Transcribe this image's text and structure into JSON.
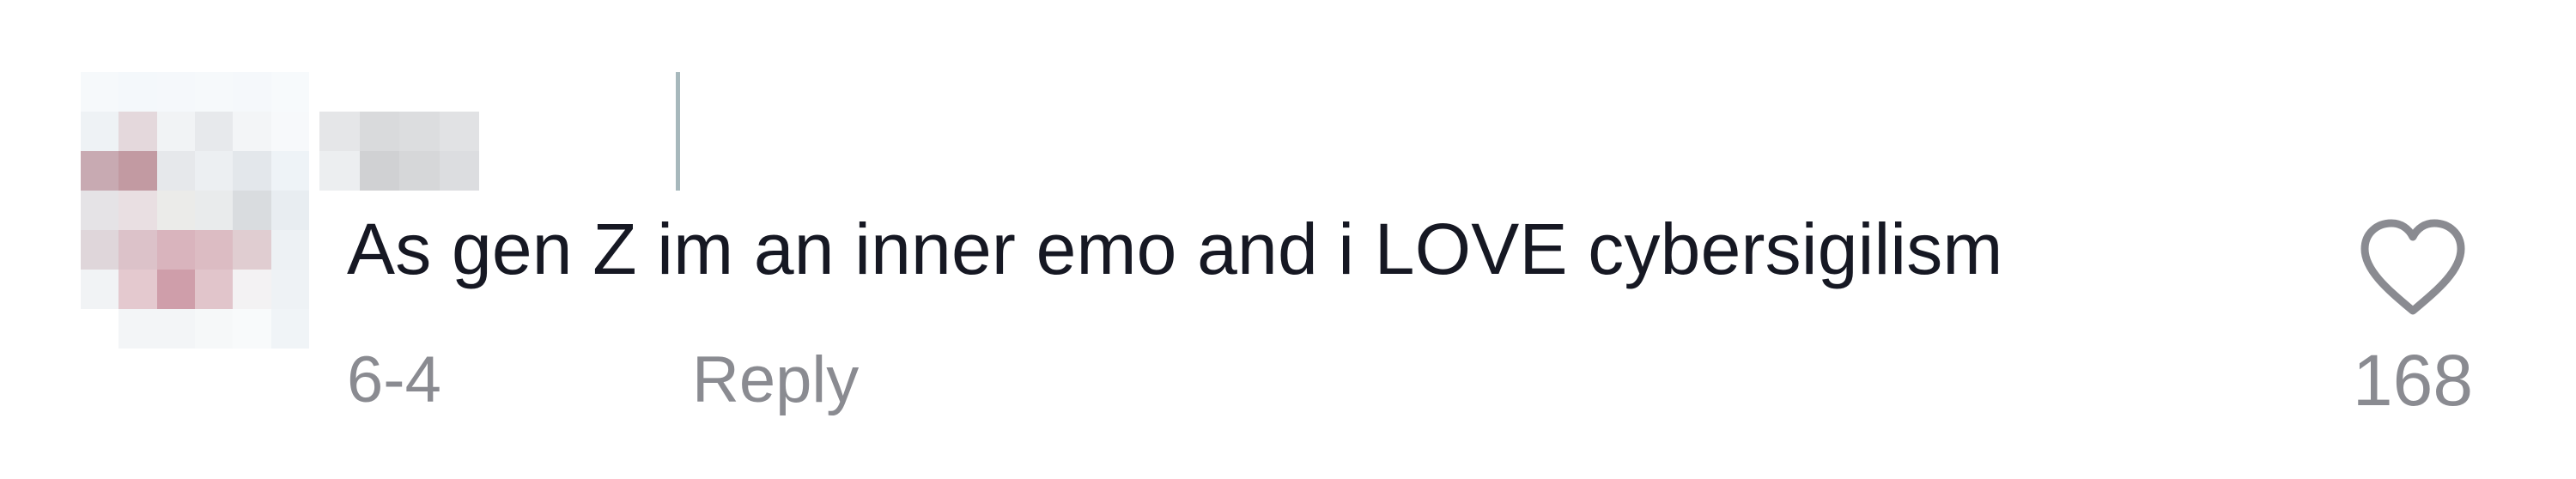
{
  "comment": {
    "text": "As gen Z im an inner emo and i LOVE cybersigilism",
    "date": "6-4",
    "reply_label": "Reply",
    "like_count": "168",
    "like_icon": "heart-outline-icon"
  },
  "colors": {
    "text_primary": "#161823",
    "text_secondary": "#8a8b91",
    "heart_stroke": "#8a8b91"
  }
}
